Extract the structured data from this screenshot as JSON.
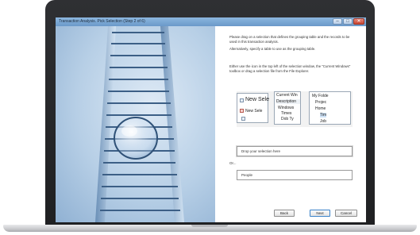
{
  "window": {
    "title": "Transaction Analysis. Pick Selection (Step 2 of 6)",
    "controls": {
      "minimize_icon": "minimize-icon",
      "maximize_icon": "maximize-icon",
      "close_icon": "close-icon"
    }
  },
  "panel": {
    "instruction_1": "Please drag on a selection that defines the grouping table and the records to be used in this transaction analysis.",
    "instruction_2": "Alternatively, specify a table to use as the grouping table.",
    "instruction_3": "Either use the icon in the top left of the selection window, the \"Current Windows\" toolbox or drag a selection file from the File Explorer.",
    "sample": {
      "win1_title": "New Sele",
      "win1_item": "New Sele",
      "win2_title": "Current Win",
      "win2_header": "Description",
      "win2_rows": [
        "Windows",
        "Times",
        "Dob Ty"
      ],
      "win3_rows": [
        "My Folde",
        "Projec",
        "Home",
        "Tim",
        "Job"
      ]
    },
    "drop_placeholder": "Drop your selection here",
    "or_label": "Or...",
    "table_value": "People"
  },
  "buttons": {
    "back": "Back",
    "next": "Next",
    "cancel": "Cancel"
  },
  "colors": {
    "accent": "#3b83c9",
    "titlebar": "#6a99c9",
    "close": "#c9432f"
  }
}
